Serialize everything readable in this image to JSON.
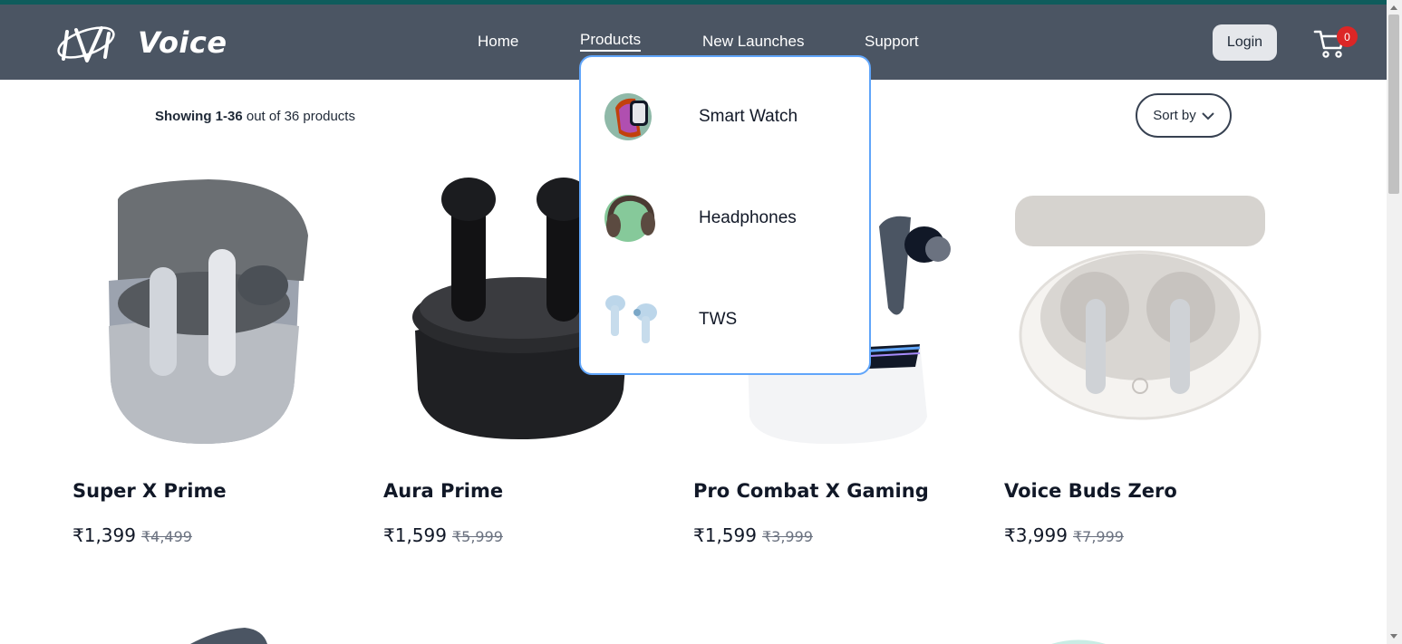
{
  "header": {
    "brand": "Voice",
    "nav": [
      "Home",
      "Products",
      "New Launches",
      "Support"
    ],
    "login_label": "Login",
    "cart_count": "0"
  },
  "listing": {
    "showing_prefix": "Showing",
    "showing_range": "1-36",
    "showing_suffix": "out of 36 products",
    "sort_label": "Sort by"
  },
  "products_menu": [
    {
      "label": "Smart Watch",
      "icon": "smartwatch-thumb"
    },
    {
      "label": "Headphones",
      "icon": "headphones-thumb"
    },
    {
      "label": "TWS",
      "icon": "earbuds-thumb"
    }
  ],
  "products": [
    {
      "name": "Super X Prime",
      "price": "₹1,399",
      "mrp": "₹4,499"
    },
    {
      "name": "Aura Prime",
      "price": "₹1,599",
      "mrp": "₹5,999"
    },
    {
      "name": "Pro Combat X Gaming",
      "price": "₹1,599",
      "mrp": "₹3,999"
    },
    {
      "name": "Voice Buds Zero",
      "price": "₹3,999",
      "mrp": "₹7,999"
    }
  ],
  "colors": {
    "navbar": "#4b5563",
    "accent": "#0f5c5c",
    "badge": "#dc2626",
    "dropdown_border": "#60a5fa"
  }
}
